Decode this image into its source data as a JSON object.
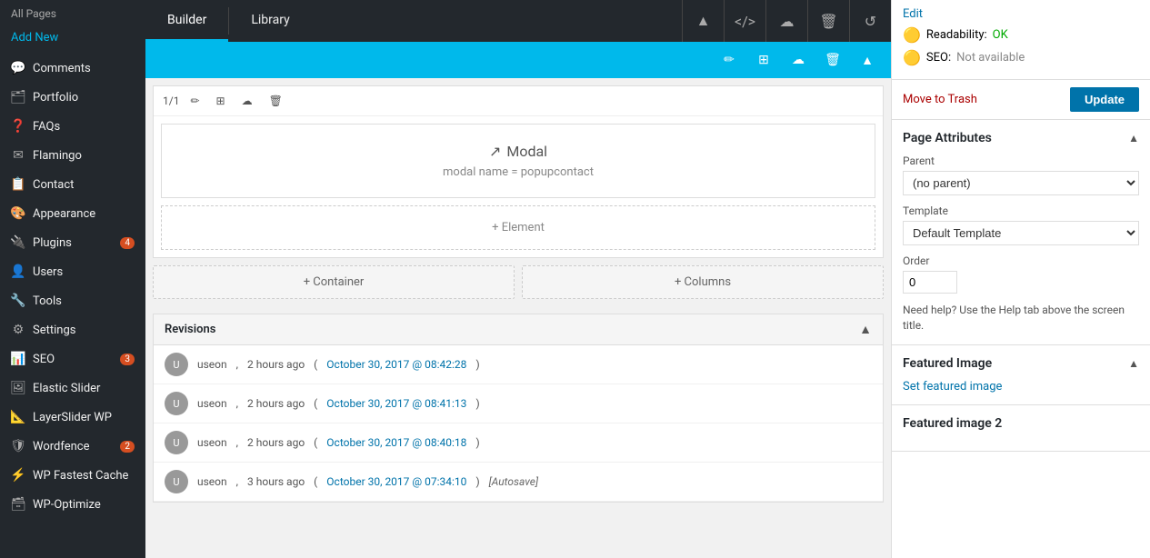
{
  "sidebar": {
    "header": "All Pages",
    "add_new": "Add New",
    "items": [
      {
        "id": "comments",
        "label": "Comments",
        "icon": "💬",
        "badge": null
      },
      {
        "id": "portfolio",
        "label": "Portfolio",
        "icon": "🗂",
        "badge": null
      },
      {
        "id": "faqs",
        "label": "FAQs",
        "icon": "❓",
        "badge": null
      },
      {
        "id": "flamingo",
        "label": "Flamingo",
        "icon": "✉",
        "badge": null
      },
      {
        "id": "contact",
        "label": "Contact",
        "icon": "📋",
        "badge": null
      },
      {
        "id": "appearance",
        "label": "Appearance",
        "icon": "🎨",
        "badge": null
      },
      {
        "id": "plugins",
        "label": "Plugins",
        "icon": "🔌",
        "badge": "4"
      },
      {
        "id": "users",
        "label": "Users",
        "icon": "👤",
        "badge": null
      },
      {
        "id": "tools",
        "label": "Tools",
        "icon": "🔧",
        "badge": null
      },
      {
        "id": "settings",
        "label": "Settings",
        "icon": "⚙",
        "badge": null
      },
      {
        "id": "seo",
        "label": "SEO",
        "icon": "📊",
        "badge": "3"
      },
      {
        "id": "elastic-slider",
        "label": "Elastic Slider",
        "icon": "🖼",
        "badge": null
      },
      {
        "id": "layerslider",
        "label": "LayerSlider WP",
        "icon": "📐",
        "badge": null
      },
      {
        "id": "wordfence",
        "label": "Wordfence",
        "icon": "🛡",
        "badge": "2"
      },
      {
        "id": "wp-fastest",
        "label": "WP Fastest Cache",
        "icon": "⚡",
        "badge": null
      },
      {
        "id": "wp-optimize",
        "label": "WP-Optimize",
        "icon": "🗃",
        "badge": null
      }
    ]
  },
  "builder": {
    "tabs": [
      {
        "id": "builder",
        "label": "Builder",
        "active": true
      },
      {
        "id": "library",
        "label": "Library",
        "active": false
      }
    ],
    "action_icons": [
      "▲",
      "</>",
      "☁",
      "🗑",
      "↺"
    ]
  },
  "blue_toolbar": {
    "action_icons": [
      "✏",
      "⊞",
      "☁",
      "🗑",
      "▲"
    ]
  },
  "section": {
    "count": "1/1",
    "icons": [
      "✏",
      "⊞",
      "☁",
      "🗑"
    ]
  },
  "modal_block": {
    "icon": "↗",
    "title": "Modal",
    "subtitle": "modal name = popupcontact"
  },
  "element_block": {
    "label": "+ Element"
  },
  "add_buttons": [
    {
      "id": "container",
      "label": "+ Container"
    },
    {
      "id": "columns",
      "label": "+ Columns"
    }
  ],
  "revisions": {
    "title": "Revisions",
    "items": [
      {
        "user": "useon",
        "time": "2 hours ago",
        "link_text": "October 30, 2017 @ 08:42:28",
        "autosave": null
      },
      {
        "user": "useon",
        "time": "2 hours ago",
        "link_text": "October 30, 2017 @ 08:41:13",
        "autosave": null
      },
      {
        "user": "useon",
        "time": "2 hours ago",
        "link_text": "October 30, 2017 @ 08:40:18",
        "autosave": null
      },
      {
        "user": "useon",
        "time": "3 hours ago",
        "link_text": "October 30, 2017 @ 07:34:10",
        "autosave": "[Autosave]"
      }
    ]
  },
  "right_panel": {
    "edit_link": "Edit",
    "readability_label": "Readability:",
    "readability_value": "OK",
    "seo_label": "SEO:",
    "seo_value": "Not available",
    "move_to_trash": "Move to Trash",
    "update_button": "Update",
    "page_attributes": {
      "title": "Page Attributes",
      "parent_label": "Parent",
      "parent_value": "(no parent)",
      "template_label": "Template",
      "template_value": "Default Template",
      "order_label": "Order",
      "order_value": "0",
      "help_text": "Need help? Use the Help tab above the screen title."
    },
    "featured_image": {
      "title": "Featured Image",
      "set_link": "Set featured image"
    },
    "featured_image2": {
      "title": "Featured image 2"
    }
  }
}
